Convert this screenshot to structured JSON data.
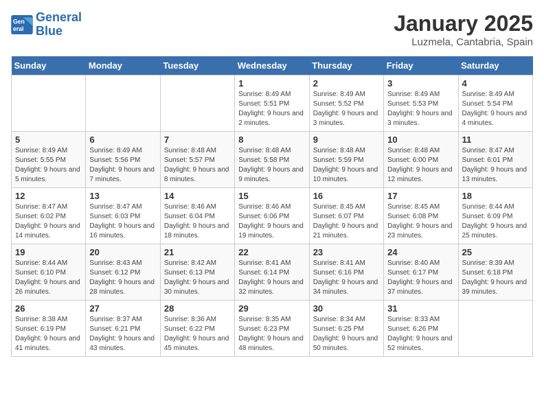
{
  "logo": {
    "line1": "General",
    "line2": "Blue"
  },
  "title": "January 2025",
  "location": "Luzmela, Cantabria, Spain",
  "days_of_week": [
    "Sunday",
    "Monday",
    "Tuesday",
    "Wednesday",
    "Thursday",
    "Friday",
    "Saturday"
  ],
  "weeks": [
    [
      {
        "num": "",
        "empty": true
      },
      {
        "num": "",
        "empty": true
      },
      {
        "num": "",
        "empty": true
      },
      {
        "num": "1",
        "sunrise": "8:49 AM",
        "sunset": "5:51 PM",
        "daylight": "9 hours and 2 minutes."
      },
      {
        "num": "2",
        "sunrise": "8:49 AM",
        "sunset": "5:52 PM",
        "daylight": "9 hours and 3 minutes."
      },
      {
        "num": "3",
        "sunrise": "8:49 AM",
        "sunset": "5:53 PM",
        "daylight": "9 hours and 3 minutes."
      },
      {
        "num": "4",
        "sunrise": "8:49 AM",
        "sunset": "5:54 PM",
        "daylight": "9 hours and 4 minutes."
      }
    ],
    [
      {
        "num": "5",
        "sunrise": "8:49 AM",
        "sunset": "5:55 PM",
        "daylight": "9 hours and 5 minutes."
      },
      {
        "num": "6",
        "sunrise": "8:49 AM",
        "sunset": "5:56 PM",
        "daylight": "9 hours and 7 minutes."
      },
      {
        "num": "7",
        "sunrise": "8:48 AM",
        "sunset": "5:57 PM",
        "daylight": "9 hours and 8 minutes."
      },
      {
        "num": "8",
        "sunrise": "8:48 AM",
        "sunset": "5:58 PM",
        "daylight": "9 hours and 9 minutes."
      },
      {
        "num": "9",
        "sunrise": "8:48 AM",
        "sunset": "5:59 PM",
        "daylight": "9 hours and 10 minutes."
      },
      {
        "num": "10",
        "sunrise": "8:48 AM",
        "sunset": "6:00 PM",
        "daylight": "9 hours and 12 minutes."
      },
      {
        "num": "11",
        "sunrise": "8:47 AM",
        "sunset": "6:01 PM",
        "daylight": "9 hours and 13 minutes."
      }
    ],
    [
      {
        "num": "12",
        "sunrise": "8:47 AM",
        "sunset": "6:02 PM",
        "daylight": "9 hours and 14 minutes."
      },
      {
        "num": "13",
        "sunrise": "8:47 AM",
        "sunset": "6:03 PM",
        "daylight": "9 hours and 16 minutes."
      },
      {
        "num": "14",
        "sunrise": "8:46 AM",
        "sunset": "6:04 PM",
        "daylight": "9 hours and 18 minutes."
      },
      {
        "num": "15",
        "sunrise": "8:46 AM",
        "sunset": "6:06 PM",
        "daylight": "9 hours and 19 minutes."
      },
      {
        "num": "16",
        "sunrise": "8:45 AM",
        "sunset": "6:07 PM",
        "daylight": "9 hours and 21 minutes."
      },
      {
        "num": "17",
        "sunrise": "8:45 AM",
        "sunset": "6:08 PM",
        "daylight": "9 hours and 23 minutes."
      },
      {
        "num": "18",
        "sunrise": "8:44 AM",
        "sunset": "6:09 PM",
        "daylight": "9 hours and 25 minutes."
      }
    ],
    [
      {
        "num": "19",
        "sunrise": "8:44 AM",
        "sunset": "6:10 PM",
        "daylight": "9 hours and 26 minutes."
      },
      {
        "num": "20",
        "sunrise": "8:43 AM",
        "sunset": "6:12 PM",
        "daylight": "9 hours and 28 minutes."
      },
      {
        "num": "21",
        "sunrise": "8:42 AM",
        "sunset": "6:13 PM",
        "daylight": "9 hours and 30 minutes."
      },
      {
        "num": "22",
        "sunrise": "8:41 AM",
        "sunset": "6:14 PM",
        "daylight": "9 hours and 32 minutes."
      },
      {
        "num": "23",
        "sunrise": "8:41 AM",
        "sunset": "6:16 PM",
        "daylight": "9 hours and 34 minutes."
      },
      {
        "num": "24",
        "sunrise": "8:40 AM",
        "sunset": "6:17 PM",
        "daylight": "9 hours and 37 minutes."
      },
      {
        "num": "25",
        "sunrise": "8:39 AM",
        "sunset": "6:18 PM",
        "daylight": "9 hours and 39 minutes."
      }
    ],
    [
      {
        "num": "26",
        "sunrise": "8:38 AM",
        "sunset": "6:19 PM",
        "daylight": "9 hours and 41 minutes."
      },
      {
        "num": "27",
        "sunrise": "8:37 AM",
        "sunset": "6:21 PM",
        "daylight": "9 hours and 43 minutes."
      },
      {
        "num": "28",
        "sunrise": "8:36 AM",
        "sunset": "6:22 PM",
        "daylight": "9 hours and 45 minutes."
      },
      {
        "num": "29",
        "sunrise": "8:35 AM",
        "sunset": "6:23 PM",
        "daylight": "9 hours and 48 minutes."
      },
      {
        "num": "30",
        "sunrise": "8:34 AM",
        "sunset": "6:25 PM",
        "daylight": "9 hours and 50 minutes."
      },
      {
        "num": "31",
        "sunrise": "8:33 AM",
        "sunset": "6:26 PM",
        "daylight": "9 hours and 52 minutes."
      },
      {
        "num": "",
        "empty": true
      }
    ]
  ]
}
